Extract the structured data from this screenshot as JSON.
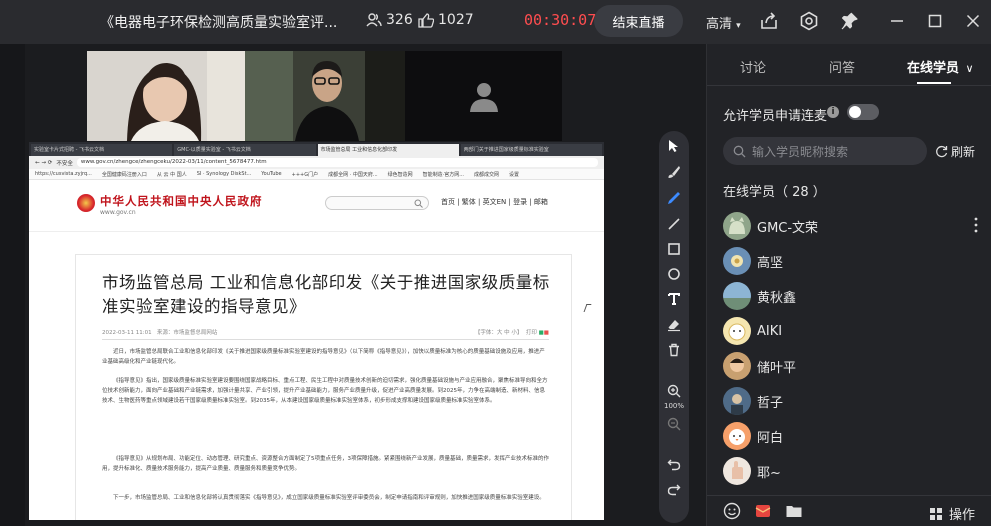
{
  "window": {
    "title": "《电器电子环保检测高质量实验室评...",
    "viewers": "326",
    "likes": "1027",
    "timer": "00:30:07",
    "end_live_label": "结束直播",
    "quality_label": "高清"
  },
  "shared_screen": {
    "browser_tabs": [
      "实验室卡片式招聘 - 飞书云文档",
      "GMC-以质量实验室 - 飞书云文档",
      "市场监管总局 工业和信息化部印发",
      "两部门关于推进国家级质量标准实验室"
    ],
    "address": "www.gov.cn/zhengce/zhengceku/2022-03/11/content_5678477.htm",
    "address_security": "不安全",
    "bookmarks": [
      "https://cusvista.zyjrq...",
      "全国健康码注册入口",
      "从 云 中 国人",
      "SI · Synology DiskSt...",
      "YouTube",
      "+++G门户",
      "成都全网 · 中国天府...",
      "绿色智造网",
      "智能制造·官方网...",
      "成都成交网",
      "设置"
    ],
    "site": {
      "name": "中华人民共和国中央人民政府",
      "url": "www.gov.cn",
      "links": "首页 | 繁体 | 英文EN | 登录 | 邮箱"
    },
    "article": {
      "title": "市场监管总局 工业和信息化部印发《关于推进国家级质量标准实验室建设的指导意见》",
      "date": "2022-03-11 11:01",
      "source": "来源：市场监督总局网站",
      "font_size": "【字体：大 中 小】",
      "print": "打印",
      "paragraphs": [
        "近日，市场监管总局联合工业和信息化部印发《关于推进国家级质量标准实验室建设的指导意见》（以下简称《指导意见》），加快以质量标准为核心的质量基础设施及应用，推进产业基础高级化和产业链现代化。",
        "《指导意见》指出，国家级质量标准实验室建设要围绕国家战略目标、重点工程、民生工程中对质量技术创新的迫切需求，强化质量基础设施与产业应用融合，聚焦标准导向和全方位技术创新能力，面向产业基础和产业链需求，加强计量共享、产业引领，提升产业基础能力，服务产业质量升级，促进产业高质量发展。到2025年，力争在高端制造、新材料、信息技术、生物医药等重点领域建设若干国家级质量标准实验室。到2035年，从本建设国家级质量标准实验室体系，初步形成支撑和建设国家级质量标准实验室体系。",
        "《指导意见》从规划布局、功能定位、动态管理、研究重点、资源整合方面制定了5项重点任务，3项保障措施。紧紧围绕新产业发展，质量基础，质量需求，发挥产业技术标准的作用，提升标准化、质量技术服务能力，提高产业质量、质量服务和质量竞争优势。",
        "下一步，市场监管总局、工业和信息化部将认真贯彻落实《指导意见》，成立国家级质量标准实验室评审委员会，制定申请指南和评审规则，加快推进国家级质量标准实验室建设。"
      ]
    }
  },
  "toolbar": {
    "zoom": "100%"
  },
  "panel": {
    "tabs": [
      "讨论",
      "问答",
      "在线学员"
    ],
    "allow_connect_label": "允许学员申请连麦",
    "search_placeholder": "输入学员昵称搜索",
    "refresh_label": "刷新",
    "online_title": "在线学员（ 28 ）",
    "members": [
      {
        "name": "GMC-文荣",
        "avatar": "cat-avatar"
      },
      {
        "name": "高坚",
        "avatar": "flower-avatar"
      },
      {
        "name": "黄秋鑫",
        "avatar": "landscape-avatar"
      },
      {
        "name": "AIKI",
        "avatar": "cartoon-avatar"
      },
      {
        "name": "储叶平",
        "avatar": "child-avatar"
      },
      {
        "name": "哲子",
        "avatar": "scenery-avatar"
      },
      {
        "name": "阿白",
        "avatar": "chick-avatar"
      },
      {
        "name": "耶~",
        "avatar": "hand-avatar"
      }
    ],
    "ops_label": "操作"
  },
  "colors": {
    "timer": "#ff4d4f",
    "gov_red": "#c0141c",
    "panel_bg": "#222327",
    "accent_pen": "#3d8bff"
  }
}
